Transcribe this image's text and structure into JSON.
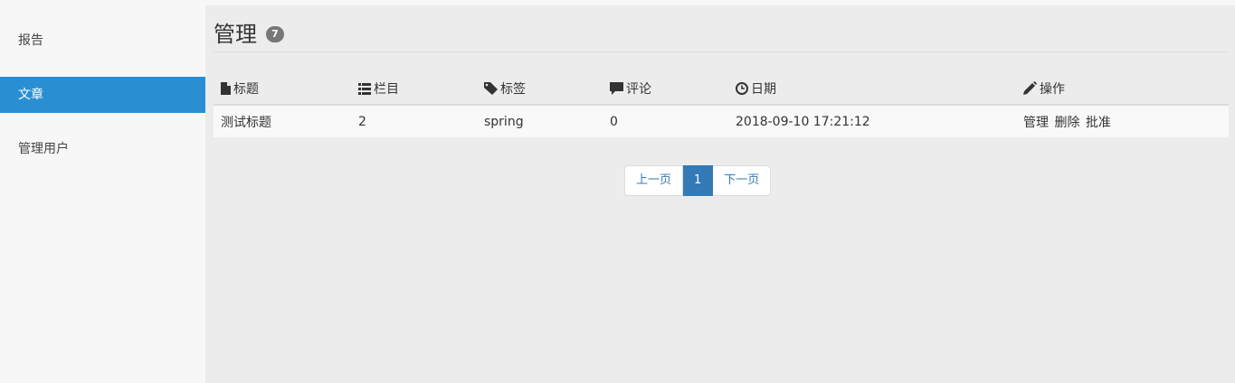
{
  "sidebar": {
    "items": [
      {
        "label": "报告"
      },
      {
        "label": "文章"
      },
      {
        "label": "管理用户"
      }
    ]
  },
  "header": {
    "title": "管理",
    "badge": "7"
  },
  "table": {
    "columns": [
      {
        "label": "标题",
        "icon": "file-icon"
      },
      {
        "label": "栏目",
        "icon": "list-icon"
      },
      {
        "label": "标签",
        "icon": "tag-icon"
      },
      {
        "label": "评论",
        "icon": "comment-icon"
      },
      {
        "label": "日期",
        "icon": "clock-icon"
      },
      {
        "label": "操作",
        "icon": "pencil-icon"
      }
    ],
    "rows": [
      {
        "title": "测试标题",
        "column": "2",
        "tag": "spring",
        "comments": "0",
        "date": "2018-09-10 17:21:12",
        "actions": [
          "管理",
          "删除",
          "批准"
        ]
      }
    ]
  },
  "pagination": {
    "prev": "上一页",
    "current": "1",
    "next": "下一页"
  },
  "colors": {
    "accent": "#2a8fd2",
    "pager_active": "#337ab7",
    "badge": "#777777"
  }
}
